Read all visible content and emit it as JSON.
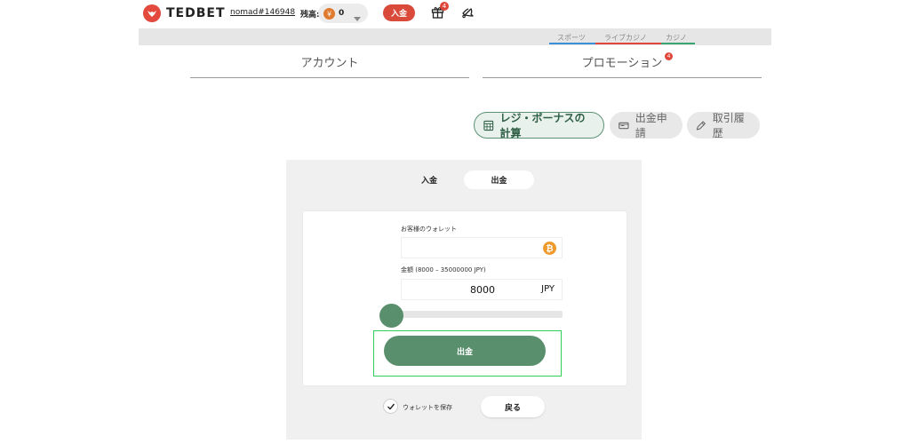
{
  "header": {
    "logo_text": "TEDBET",
    "username": "nomad#146948",
    "balance_label": "残高:",
    "balance_value": "0",
    "deposit_button": "入金",
    "gift_badge_count": "4"
  },
  "game_tabs": [
    {
      "label": "スポーツ",
      "color": "#3b8fd6"
    },
    {
      "label": "ライブカジノ",
      "color": "#e0463a"
    },
    {
      "label": "カジノ",
      "color": "#3aa372"
    }
  ],
  "main_tabs": {
    "account": "アカウント",
    "promotion": "プロモーション",
    "promotion_badge": "4"
  },
  "actions": {
    "calculator": "レジ・ボーナスの計算",
    "withdraw_request": "出金申請",
    "history": "取引履歴"
  },
  "panel": {
    "tabs": {
      "deposit": "入金",
      "withdraw": "出金"
    },
    "wallet_label": "お客様のウォレット",
    "wallet_value": "",
    "amount_label": "金額 (8000 – 35000000 JPY)",
    "amount_value": "8000",
    "amount_currency": "JPY",
    "slider_fraction": 0.0,
    "withdraw_button": "出金",
    "save_wallet_label": "ウォレットを保存",
    "back_button": "戻る"
  },
  "colors": {
    "brand_red": "#d94a3b",
    "accent_green": "#5a8f6d",
    "highlight": "#2fcf59"
  }
}
